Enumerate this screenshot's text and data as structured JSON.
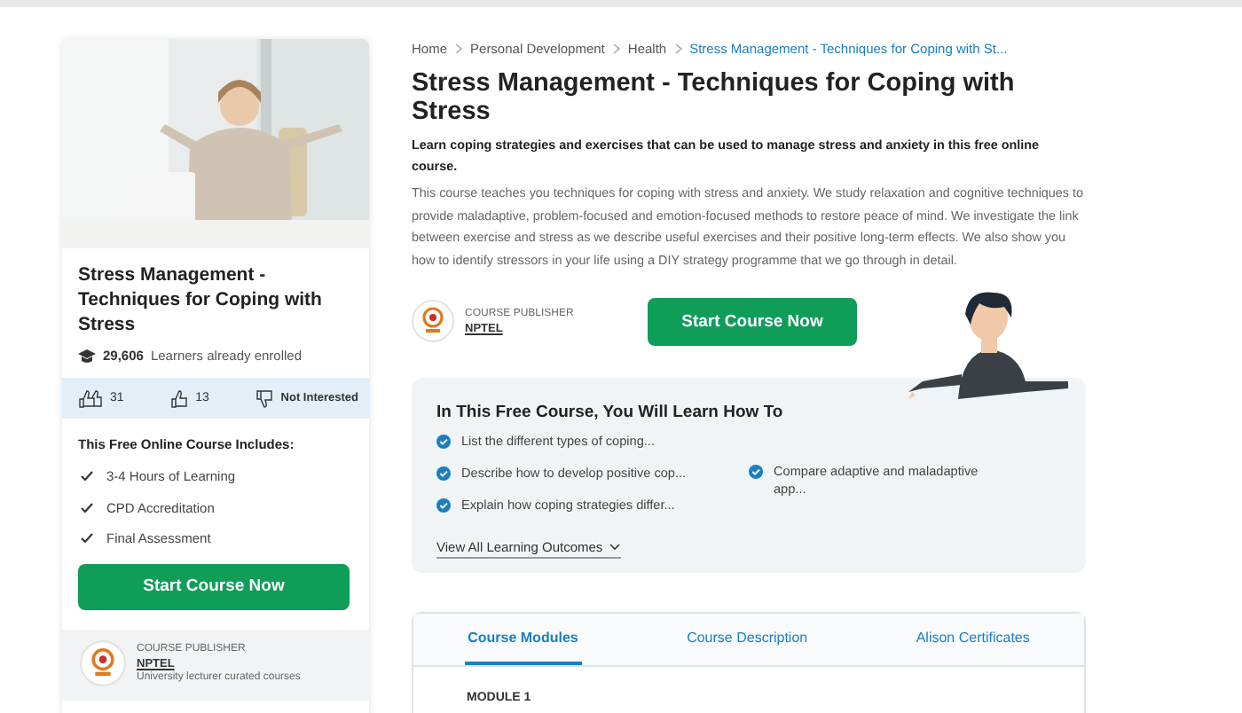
{
  "breadcrumb": [
    {
      "label": "Home",
      "selected": false
    },
    {
      "label": "Personal Development",
      "selected": false
    },
    {
      "label": "Health",
      "selected": false
    },
    {
      "label": "Stress Management - Techniques for Coping with St...",
      "selected": true
    }
  ],
  "card": {
    "title": "Stress Management - Techniques for Coping with Stress",
    "enrolled_count": "29,606",
    "enrolled_label": "Learners already enrolled",
    "likes": "31",
    "thumbs_up": "13",
    "not_interested": "Not Interested",
    "includes_title": "This Free Online Course Includes:",
    "includes": [
      "3-4 Hours of Learning",
      "CPD Accreditation",
      "Final Assessment"
    ],
    "button": "Start Course Now",
    "publisher": {
      "label": "COURSE PUBLISHER",
      "name": "NPTEL",
      "tagline": "University lecturer curated courses"
    }
  },
  "course": {
    "title": "Stress Management - Techniques for Coping with Stress",
    "subtitle": "Learn coping strategies and exercises that can be used to manage stress and anxiety in this free online course.",
    "description": "This course teaches you techniques for coping with stress and anxiety. We study relaxation and cognitive techniques to provide maladaptive, problem-focused and emotion-focused methods to restore peace of mind. We investigate the link between exercise and stress as we describe useful exercises and their positive long-term effects. We also show you how to identify stressors in your life using a DIY strategy programme that we go through in detail.",
    "publisher": {
      "label": "COURSE PUBLISHER",
      "name": "NPTEL"
    },
    "button": "Start Course Now"
  },
  "outcomes": {
    "title": "In This Free Course, You Will Learn How To",
    "items": [
      "List the different types of coping...",
      "Describe how to develop positive cop...",
      "Explain how coping strategies differ...",
      "Compare adaptive and maladaptive app..."
    ],
    "link": "View All Learning Outcomes"
  },
  "tabs": [
    {
      "label": "Course Modules",
      "selected": true
    },
    {
      "label": "Course Description",
      "selected": false
    },
    {
      "label": "Alison Certificates",
      "selected": false
    }
  ],
  "module": "MODULE 1"
}
